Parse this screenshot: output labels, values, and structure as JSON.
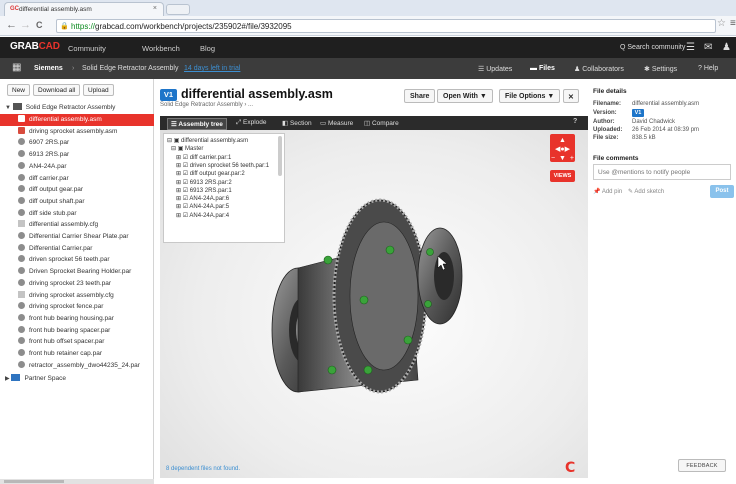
{
  "browser": {
    "tab_icon": "GC",
    "tab_title": "differential assembly.asm",
    "tab_close": "×",
    "address_scheme": "https://",
    "address_rest": "grabcad.com/workbench/projects/235902#/file/3932095",
    "back_glyph": "←",
    "forward_glyph": "→",
    "reload_glyph": "C",
    "star_glyph": "☆",
    "menu_glyph": "≡"
  },
  "header": {
    "logo_grab": "GRAB",
    "logo_cad": "CAD",
    "nav": [
      "Community",
      "Workbench",
      "Blog"
    ],
    "search_label": "Q  Search community",
    "icons": [
      "hamburger-icon",
      "mail-icon",
      "user-icon"
    ]
  },
  "project_bar": {
    "org": "Siemens",
    "separator": "›",
    "project": "Solid Edge Retractor Assembly",
    "days_left": "14 days left in trial",
    "nav": [
      {
        "icon": "☰",
        "label": "Updates",
        "active": false
      },
      {
        "icon": "▬",
        "label": "Files",
        "active": true
      },
      {
        "icon": "♟",
        "label": "Collaborators",
        "active": false
      },
      {
        "icon": "✱",
        "label": "Settings",
        "active": false
      },
      {
        "icon": "?",
        "label": "Help",
        "active": false
      }
    ]
  },
  "left_panel": {
    "buttons": [
      "New",
      "Download all",
      "Upload"
    ],
    "root": "Solid Edge Retractor Assembly",
    "files": [
      {
        "name": "differential assembly.asm",
        "type": "asm",
        "selected": true
      },
      {
        "name": "driving sprocket assembly.asm",
        "type": "asm",
        "selected": false
      },
      {
        "name": "6907 2RS.par",
        "type": "par",
        "selected": false
      },
      {
        "name": "6913 2RS.par",
        "type": "par",
        "selected": false
      },
      {
        "name": "AN4-24A.par",
        "type": "par",
        "selected": false
      },
      {
        "name": "diff carrier.par",
        "type": "par",
        "selected": false
      },
      {
        "name": "diff output gear.par",
        "type": "par",
        "selected": false
      },
      {
        "name": "diff output shaft.par",
        "type": "par",
        "selected": false
      },
      {
        "name": "diff side stub.par",
        "type": "par",
        "selected": false
      },
      {
        "name": "differential assembly.cfg",
        "type": "cfg",
        "selected": false
      },
      {
        "name": "Differential Carrier Shear Plate.par",
        "type": "par",
        "selected": false
      },
      {
        "name": "Differential Carrier.par",
        "type": "par",
        "selected": false
      },
      {
        "name": "driven sprocket 56 teeth.par",
        "type": "par",
        "selected": false
      },
      {
        "name": "Driven Sprocket Bearing Holder.par",
        "type": "par",
        "selected": false
      },
      {
        "name": "driving sprocket 23 teeth.par",
        "type": "par",
        "selected": false
      },
      {
        "name": "driving sprocket assembly.cfg",
        "type": "cfg",
        "selected": false
      },
      {
        "name": "driving sprocket fence.par",
        "type": "par",
        "selected": false
      },
      {
        "name": "front hub bearing housing.par",
        "type": "par",
        "selected": false
      },
      {
        "name": "front hub bearing spacer.par",
        "type": "par",
        "selected": false
      },
      {
        "name": "front hub offset spacer.par",
        "type": "par",
        "selected": false
      },
      {
        "name": "front hub retainer cap.par",
        "type": "par",
        "selected": false
      },
      {
        "name": "retractor_assembly_dwo44235_24.par",
        "type": "par",
        "selected": false
      }
    ],
    "partner_space": "Partner Space"
  },
  "file_header": {
    "version_badge": "V1",
    "title": "differential assembly.asm",
    "breadcrumb": "Solid Edge Retractor Assembly ›  ...",
    "share": "Share",
    "open_with": "Open With ▼",
    "file_options": "File Options ▼",
    "expand_icon": "✕"
  },
  "viewer": {
    "tools": [
      "Assembly tree",
      "Explode",
      "Section",
      "Measure",
      "Compare"
    ],
    "tool_icons": [
      "☰",
      "⤢",
      "◧",
      "▭",
      "◫"
    ],
    "help": "?",
    "tree": [
      "⊟ ▣  differential assembly.asm",
      "⊟ ▣  Master",
      "⊞ ☑  diff carrier.par:1",
      "⊞ ☑  driven sprocket 56 teeth.par:1",
      "⊞ ☑  diff output gear.par:2",
      "⊞ ☑  6913 2RS.par:2",
      "⊞ ☑  6913 2RS.par:1",
      "⊞ ☑  AN4-24A.par:6",
      "⊞ ☑  AN4-24A.par:5",
      "⊞ ☑  AN4-24A.par:4"
    ],
    "navcube_arrows": "▲\n◀●▶\n−  ▼  +",
    "views_label": "VIEWS",
    "dependent_note": "8 dependent files not found.",
    "logo_glyph": "C"
  },
  "details": {
    "title": "File details",
    "rows": [
      {
        "key": "Filename:",
        "value": "differential assembly.asm"
      },
      {
        "key": "Version:",
        "value": "V1"
      },
      {
        "key": "Author:",
        "value": "David Chadwick"
      },
      {
        "key": "Uploaded:",
        "value": "26 Feb 2014 at 08:39 pm"
      },
      {
        "key": "File size:",
        "value": "838.5 kB"
      }
    ],
    "comments_title": "File comments",
    "comment_placeholder": "Use @mentions to notify people",
    "add_pin": "Add pin",
    "add_sketch": "Add sketch",
    "post": "Post",
    "feedback": "FEEDBACK"
  }
}
